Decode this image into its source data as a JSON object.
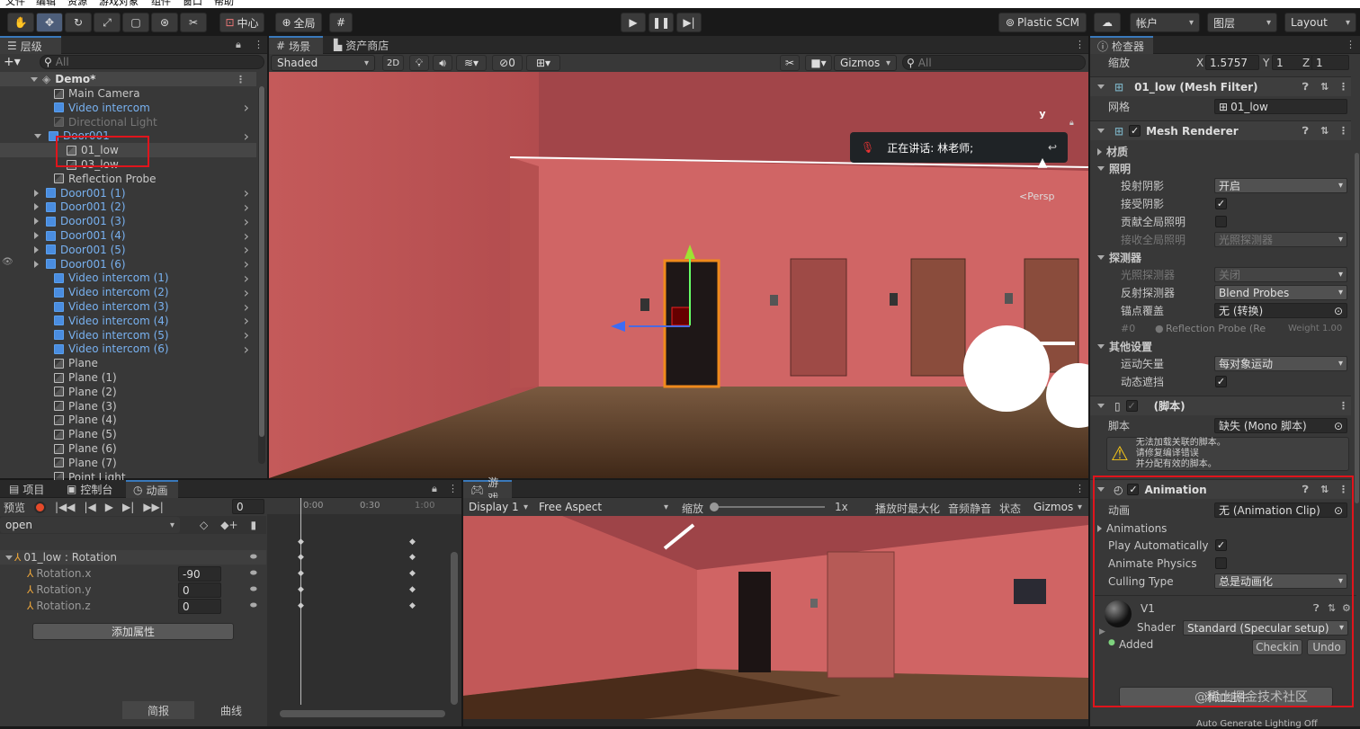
{
  "menubar": [
    "文件",
    "编辑",
    "资源",
    "游戏对象",
    "组件",
    "窗口",
    "帮助"
  ],
  "toolbar": {
    "pivot": "中心",
    "space": "全局",
    "plastic": "Plastic SCM",
    "account": "帐户",
    "layers": "图层",
    "layout": "Layout"
  },
  "hierarchy": {
    "tab": "层级",
    "search_placeholder": "All",
    "scene": "Demo*",
    "items": [
      {
        "label": "Main Camera",
        "style": "normal",
        "indent": 1
      },
      {
        "label": "Video intercom",
        "style": "blue",
        "indent": 1,
        "arrow": true
      },
      {
        "label": "Directional Light",
        "style": "grey",
        "indent": 1
      },
      {
        "label": "Door001",
        "style": "blue",
        "indent": 1,
        "expanded": true,
        "arrow": true
      },
      {
        "label": "01_low",
        "style": "normal",
        "indent": 2
      },
      {
        "label": "03_low",
        "style": "normal",
        "indent": 2
      },
      {
        "label": "Reflection Probe",
        "style": "normal",
        "indent": 1
      },
      {
        "label": "Door001 (1)",
        "style": "blue",
        "indent": 1,
        "collapsed": true,
        "arrow": true
      },
      {
        "label": "Door001 (2)",
        "style": "blue",
        "indent": 1,
        "collapsed": true,
        "arrow": true
      },
      {
        "label": "Door001 (3)",
        "style": "blue",
        "indent": 1,
        "collapsed": true,
        "arrow": true
      },
      {
        "label": "Door001 (4)",
        "style": "blue",
        "indent": 1,
        "collapsed": true,
        "arrow": true
      },
      {
        "label": "Door001 (5)",
        "style": "blue",
        "indent": 1,
        "collapsed": true,
        "arrow": true
      },
      {
        "label": "Door001 (6)",
        "style": "blue",
        "indent": 1,
        "collapsed": true,
        "arrow": true
      },
      {
        "label": "Video intercom (1)",
        "style": "blue",
        "indent": 1,
        "arrow": true
      },
      {
        "label": "Video intercom (2)",
        "style": "blue",
        "indent": 1,
        "arrow": true
      },
      {
        "label": "Video intercom (3)",
        "style": "blue",
        "indent": 1,
        "arrow": true
      },
      {
        "label": "Video intercom (4)",
        "style": "blue",
        "indent": 1,
        "arrow": true
      },
      {
        "label": "Video intercom (5)",
        "style": "blue",
        "indent": 1,
        "arrow": true
      },
      {
        "label": "Video intercom (6)",
        "style": "blue",
        "indent": 1,
        "arrow": true
      },
      {
        "label": "Plane",
        "style": "normal",
        "indent": 1
      },
      {
        "label": "Plane (1)",
        "style": "normal",
        "indent": 1
      },
      {
        "label": "Plane (2)",
        "style": "normal",
        "indent": 1
      },
      {
        "label": "Plane (3)",
        "style": "normal",
        "indent": 1
      },
      {
        "label": "Plane (4)",
        "style": "normal",
        "indent": 1
      },
      {
        "label": "Plane (5)",
        "style": "normal",
        "indent": 1
      },
      {
        "label": "Plane (6)",
        "style": "normal",
        "indent": 1
      },
      {
        "label": "Plane (7)",
        "style": "normal",
        "indent": 1
      },
      {
        "label": "Point Light",
        "style": "normal",
        "indent": 1
      }
    ]
  },
  "scene_view": {
    "tabs": [
      "场景",
      "资产商店"
    ],
    "shading": "Shaded",
    "mode2d": "2D",
    "hidden_count": "0",
    "gizmos": "Gizmos",
    "search_placeholder": "All",
    "persp": "<Persp",
    "talk": "正在讲话: 林老师;"
  },
  "bottom_left": {
    "tabs": [
      "项目",
      "控制台",
      "动画"
    ],
    "preview": "预览",
    "frame": "0",
    "clip": "open",
    "timeline": [
      "0:00",
      "0:30",
      "1:00"
    ],
    "props": [
      {
        "name": "01_low : Rotation",
        "value": ""
      },
      {
        "name": "Rotation.x",
        "value": "-90"
      },
      {
        "name": "Rotation.y",
        "value": "0"
      },
      {
        "name": "Rotation.z",
        "value": "0"
      }
    ],
    "add_prop": "添加属性",
    "dopesheet": "简报",
    "curves": "曲线"
  },
  "game_view": {
    "tab": "游戏",
    "display": "Display 1",
    "aspect": "Free Aspect",
    "scale_label": "缩放",
    "scale_value": "1x",
    "maximize": "播放时最大化",
    "mute": "音频静音",
    "stats": "状态",
    "gizmos": "Gizmos"
  },
  "inspector": {
    "tab": "检查器",
    "scale_label": "缩放",
    "scale": {
      "x": "1.5757",
      "y": "1",
      "z": "1"
    },
    "mesh_filter": "01_low (Mesh Filter)",
    "mesh_label": "网格",
    "mesh_value": "01_low",
    "mesh_renderer": "Mesh Renderer",
    "materials": "材质",
    "lighting": "照明",
    "cast_shadows": "投射阴影",
    "cast_shadows_value": "开启",
    "receive_shadows": "接受阴影",
    "contribute_gi": "贡献全局照明",
    "receive_gi": "接收全局照明",
    "receive_gi_value": "光照探测器",
    "probes": "探测器",
    "light_probes": "光照探测器",
    "light_probes_value": "关闭",
    "reflection_probes": "反射探测器",
    "reflection_probes_value": "Blend Probes",
    "anchor_override": "锚点覆盖",
    "anchor_override_value": "无 (转换)",
    "probe_index": "#0",
    "probe_name": "Reflection Probe (Re",
    "probe_weight": "Weight 1.00",
    "other_settings": "其他设置",
    "motion_vectors": "运动矢量",
    "motion_vectors_value": "每对象运动",
    "dynamic_occlusion": "动态遮挡",
    "script_comp": "(脚本)",
    "script_label": "脚本",
    "script_value": "缺失 (Mono 脚本)",
    "warning": [
      "无法加载关联的脚本。",
      "请修复编译错误",
      "并分配有效的脚本。"
    ],
    "animation": "Animation",
    "anim_label": "动画",
    "anim_value": "无 (Animation Clip)",
    "animations": "Animations",
    "play_auto": "Play Automatically",
    "animate_physics": "Animate Physics",
    "culling": "Culling Type",
    "culling_value": "总是动画化",
    "material_name": "V1",
    "shader_label": "Shader",
    "shader_value": "Standard (Specular setup)",
    "added": "Added",
    "checkin": "Checkin",
    "undo": "Undo",
    "add_component": "添加组件",
    "watermark": "@稀土掘金技术社区"
  },
  "statusbar": "Auto Generate Lighting Off"
}
